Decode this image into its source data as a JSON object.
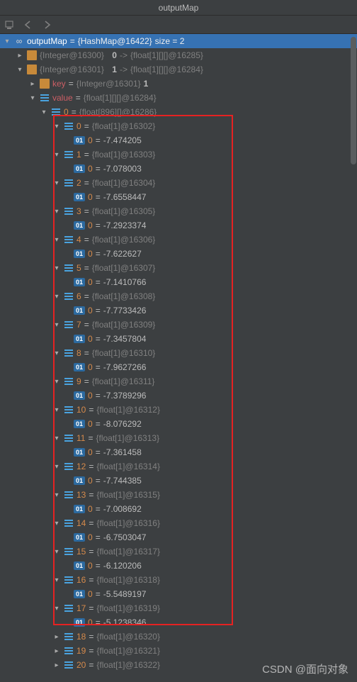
{
  "window": {
    "title": "outputMap"
  },
  "root": {
    "var": "outputMap",
    "eq": " = ",
    "type": "{HashMap@16422}",
    "size_label": "  size = 2"
  },
  "entry0": {
    "type": "{Integer@16300}",
    "key": "0",
    "arrow": " -> ",
    "val": "{float[1][][]@16285}"
  },
  "entry1": {
    "type": "{Integer@16301}",
    "key": "1",
    "arrow": " -> ",
    "val": "{float[1][][]@16284}"
  },
  "e1key": {
    "label": "key",
    "eq": " = ",
    "type": "{Integer@16301} ",
    "val": "1"
  },
  "e1val": {
    "label": "value",
    "eq": " = ",
    "type": "{float[1][][]@16284}"
  },
  "inner0": {
    "idx": "0",
    "eq": " = ",
    "type": "{float[896][]@16286}"
  },
  "items": [
    {
      "i": "0",
      "type": "{float[1]@16302}",
      "v": "-7.474205"
    },
    {
      "i": "1",
      "type": "{float[1]@16303}",
      "v": "-7.078003"
    },
    {
      "i": "2",
      "type": "{float[1]@16304}",
      "v": "-7.6558447"
    },
    {
      "i": "3",
      "type": "{float[1]@16305}",
      "v": "-7.2923374"
    },
    {
      "i": "4",
      "type": "{float[1]@16306}",
      "v": "-7.622627"
    },
    {
      "i": "5",
      "type": "{float[1]@16307}",
      "v": "-7.1410766"
    },
    {
      "i": "6",
      "type": "{float[1]@16308}",
      "v": "-7.7733426"
    },
    {
      "i": "7",
      "type": "{float[1]@16309}",
      "v": "-7.3457804"
    },
    {
      "i": "8",
      "type": "{float[1]@16310}",
      "v": "-7.9627266"
    },
    {
      "i": "9",
      "type": "{float[1]@16311}",
      "v": "-7.3789296"
    },
    {
      "i": "10",
      "type": "{float[1]@16312}",
      "v": "-8.076292"
    },
    {
      "i": "11",
      "type": "{float[1]@16313}",
      "v": "-7.361458"
    },
    {
      "i": "12",
      "type": "{float[1]@16314}",
      "v": "-7.744385"
    },
    {
      "i": "13",
      "type": "{float[1]@16315}",
      "v": "-7.008692"
    },
    {
      "i": "14",
      "type": "{float[1]@16316}",
      "v": "-6.7503047"
    },
    {
      "i": "15",
      "type": "{float[1]@16317}",
      "v": "-6.120206"
    },
    {
      "i": "16",
      "type": "{float[1]@16318}",
      "v": "-5.5489197"
    },
    {
      "i": "17",
      "type": "{float[1]@16319}",
      "v": "-5.1238346"
    }
  ],
  "tail": [
    {
      "i": "18",
      "type": "{float[1]@16320}"
    },
    {
      "i": "19",
      "type": "{float[1]@16321}"
    },
    {
      "i": "20",
      "type": "{float[1]@16322}"
    }
  ],
  "zero_label": "0",
  "zero_eq": " = ",
  "watermark": "CSDN @面向对象"
}
